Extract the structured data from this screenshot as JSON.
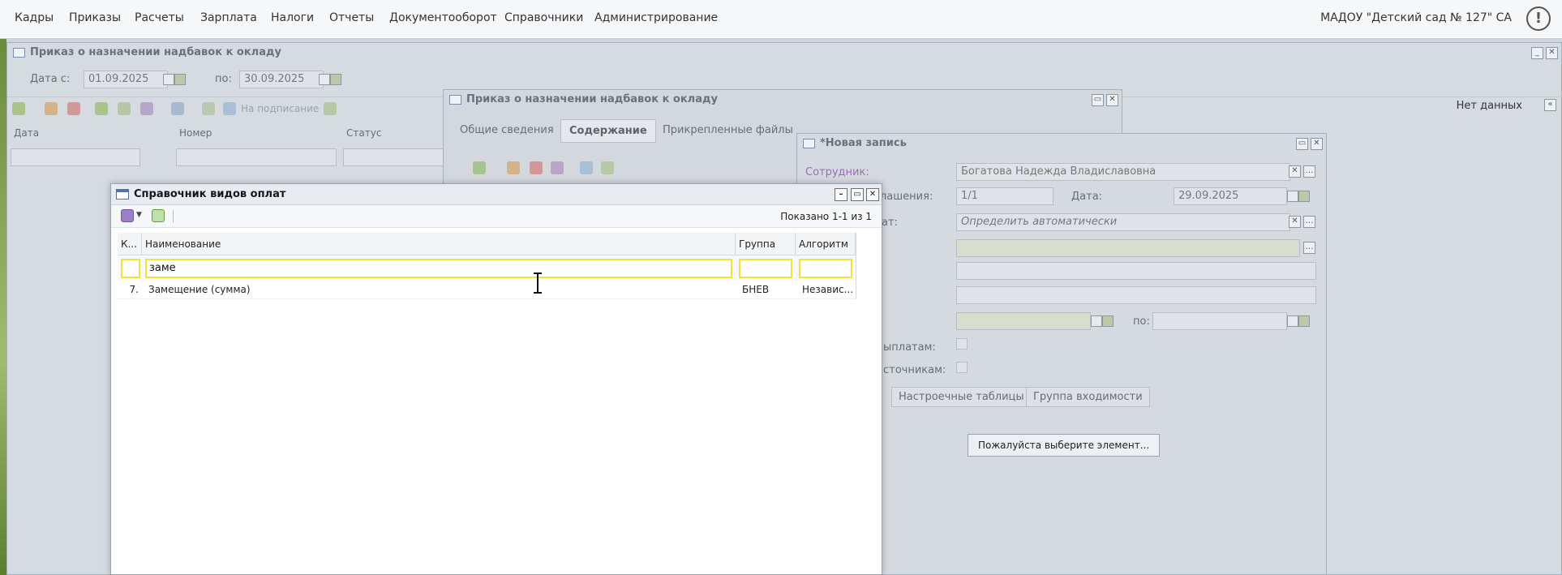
{
  "menu": {
    "items": [
      "Кадры",
      "Приказы",
      "Расчеты",
      "Зарплата",
      "Налоги",
      "Отчеты",
      "Документооборот",
      "Справочники",
      "Администрирование"
    ],
    "organization": "МАДОУ \"Детский сад № 127\" СА",
    "alert_glyph": "!"
  },
  "bg_window": {
    "title": "Приказ о назначении надбавок к окладу",
    "date_from_label": "Дата с:",
    "date_from": "01.09.2025",
    "date_to_label": "по:",
    "date_to": "30.09.2025",
    "sign_label": "На подписание",
    "no_data": "Нет данных",
    "columns": [
      "Дата",
      "Номер",
      "Статус"
    ]
  },
  "order_window": {
    "title": "Приказ о назначении надбавок к окладу",
    "tabs": [
      "Общие сведения",
      "Содержание",
      "Прикрепленные файлы"
    ],
    "active_tab": "Содержание"
  },
  "record_window": {
    "title": "*Новая запись",
    "employee_label": "Сотрудник:",
    "employee": "Богатова Надежда Владиславовна",
    "agreement_label": "лашения:",
    "agreement": "1/1",
    "date_label": "Дата:",
    "date": "29.09.2025",
    "type_label": "ат:",
    "type_placeholder": "Определить автоматически",
    "period_to_label": "по:",
    "payments_label": "ыплатам:",
    "sources_label": "сточникам:",
    "tabs": [
      "Настроечные таблицы",
      "Группа входимости"
    ],
    "select_prompt": "Пожалуйста выберите элемент..."
  },
  "dialog": {
    "title": "Справочник видов оплат",
    "shown": "Показано 1-1 из 1",
    "columns": {
      "code": "К...",
      "name": "Наименование",
      "group": "Группа",
      "algorithm": "Алгоритм"
    },
    "filter": {
      "name_value": "заме"
    },
    "rows": [
      {
        "code": "7.",
        "name": "Замещение (сумма)",
        "group": "БНЕВ",
        "algorithm": "Независ..."
      }
    ]
  }
}
